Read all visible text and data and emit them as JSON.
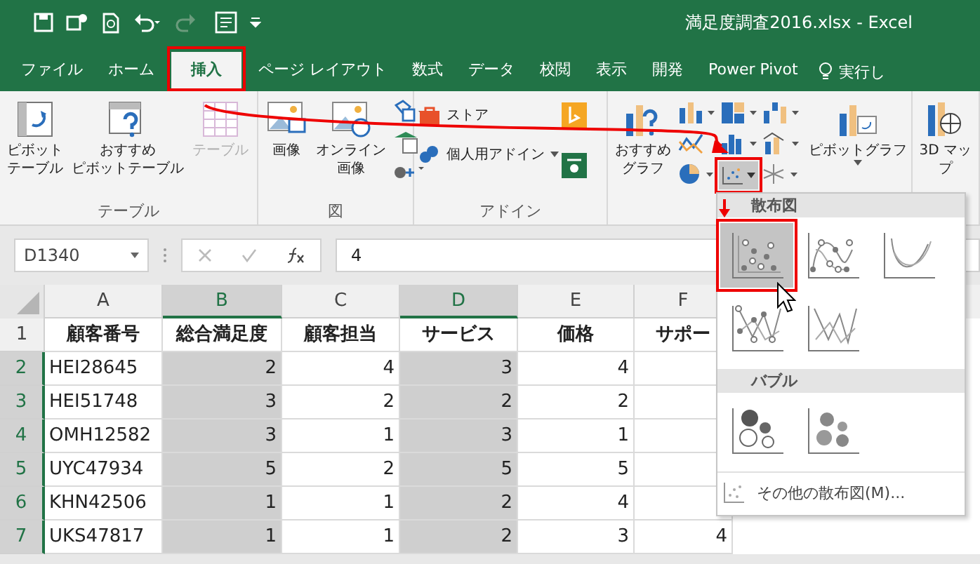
{
  "window": {
    "title": "満足度調査2016.xlsx - Excel"
  },
  "tabs": [
    {
      "label": "ファイル",
      "selected": false
    },
    {
      "label": "ホーム",
      "selected": false
    },
    {
      "label": "挿入",
      "selected": true
    },
    {
      "label": "ページ レイアウト",
      "selected": false
    },
    {
      "label": "数式",
      "selected": false
    },
    {
      "label": "データ",
      "selected": false
    },
    {
      "label": "校閲",
      "selected": false
    },
    {
      "label": "表示",
      "selected": false
    },
    {
      "label": "開発",
      "selected": false
    },
    {
      "label": "Power Pivot",
      "selected": false
    }
  ],
  "tell_me": {
    "label": "実行し"
  },
  "ribbon": {
    "groups": [
      {
        "kind": "tables",
        "label": "テーブル",
        "buttons": [
          {
            "lines": [
              "ピボット",
              "テーブル"
            ],
            "disabled": false
          },
          {
            "lines": [
              "おすすめ",
              "ピボットテーブル"
            ],
            "disabled": false
          },
          {
            "lines": [
              "テーブル"
            ],
            "disabled": true
          }
        ]
      },
      {
        "kind": "illustrations",
        "label": "図",
        "buttons": [
          {
            "lines": [
              "画像"
            ],
            "disabled": false
          },
          {
            "lines": [
              "オンライン",
              "画像"
            ],
            "disabled": false
          }
        ]
      },
      {
        "kind": "addins",
        "label": "アドイン",
        "buttons": [
          {
            "lines": [
              "ストア"
            ],
            "disabled": false
          },
          {
            "lines": [
              "個人用アドイン"
            ],
            "disabled": false
          }
        ]
      },
      {
        "kind": "charts",
        "buttons": [
          {
            "lines": [
              "おすすめ",
              "グラフ"
            ],
            "disabled": false
          },
          {
            "lines": [
              "ピボットグラフ"
            ],
            "disabled": false
          }
        ]
      },
      {
        "kind": "tours",
        "buttons": [
          {
            "lines": [
              "3D マッ",
              "プ"
            ],
            "disabled": false
          }
        ]
      }
    ]
  },
  "formula_bar": {
    "name_box": "D1340",
    "formula": "4"
  },
  "sheet": {
    "columns": [
      {
        "label": "A",
        "selected": false
      },
      {
        "label": "B",
        "selected": true
      },
      {
        "label": "C",
        "selected": false
      },
      {
        "label": "D",
        "selected": true
      },
      {
        "label": "E",
        "selected": false
      },
      {
        "label": "F",
        "selected": false
      }
    ],
    "rows": [
      {
        "number": "1",
        "selected": false,
        "cells": [
          "顧客番号",
          "総合満足度",
          "顧客担当",
          "サービス",
          "価格",
          "サポー"
        ]
      },
      {
        "number": "2",
        "selected": true,
        "cells": [
          "HEI28645",
          "2",
          "4",
          "3",
          "4"
        ]
      },
      {
        "number": "3",
        "selected": true,
        "cells": [
          "HEI51748",
          "3",
          "2",
          "2",
          "2"
        ]
      },
      {
        "number": "4",
        "selected": true,
        "cells": [
          "OMH12582",
          "3",
          "1",
          "3",
          "1"
        ]
      },
      {
        "number": "5",
        "selected": true,
        "cells": [
          "UYC47934",
          "5",
          "2",
          "5",
          "5"
        ]
      },
      {
        "number": "6",
        "selected": true,
        "cells": [
          "KHN42506",
          "1",
          "1",
          "2",
          "4"
        ]
      },
      {
        "number": "7",
        "selected": true,
        "cells": [
          "UKS47817",
          "1",
          "1",
          "2",
          "3",
          "4"
        ]
      }
    ]
  },
  "dropdown": {
    "sections": [
      {
        "title": "散布図",
        "items": [
          {
            "kind": "markers",
            "selected": true
          },
          {
            "kind": "smooth-markers",
            "selected": false
          },
          {
            "kind": "smooth",
            "selected": false
          },
          {
            "kind": "straight-markers",
            "selected": false
          },
          {
            "kind": "straight",
            "selected": false
          }
        ]
      },
      {
        "title": "バブル",
        "items": [
          {
            "kind": "bubble",
            "selected": false
          },
          {
            "kind": "bubble-3d",
            "selected": false
          }
        ]
      }
    ],
    "footer": "その他の散布図(M)..."
  }
}
